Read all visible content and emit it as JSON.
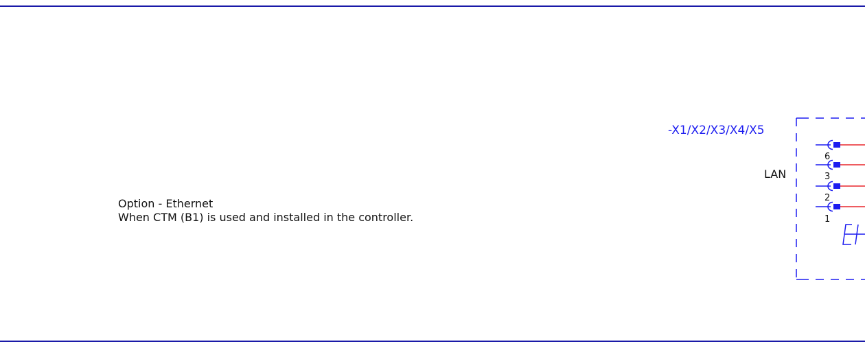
{
  "note": {
    "line1": "Option - Ethernet",
    "line2": "When CTM (B1) is used and installed in the controller."
  },
  "device": {
    "designation": "-X1/X2/X3/X4/X5",
    "port_label": "LAN",
    "pins": [
      "6",
      "3",
      "2",
      "1"
    ]
  },
  "colors": {
    "border": "#1a1aa8",
    "device_outline": "#1c1cf0",
    "wire": "#e8262b",
    "text": "#111111"
  }
}
